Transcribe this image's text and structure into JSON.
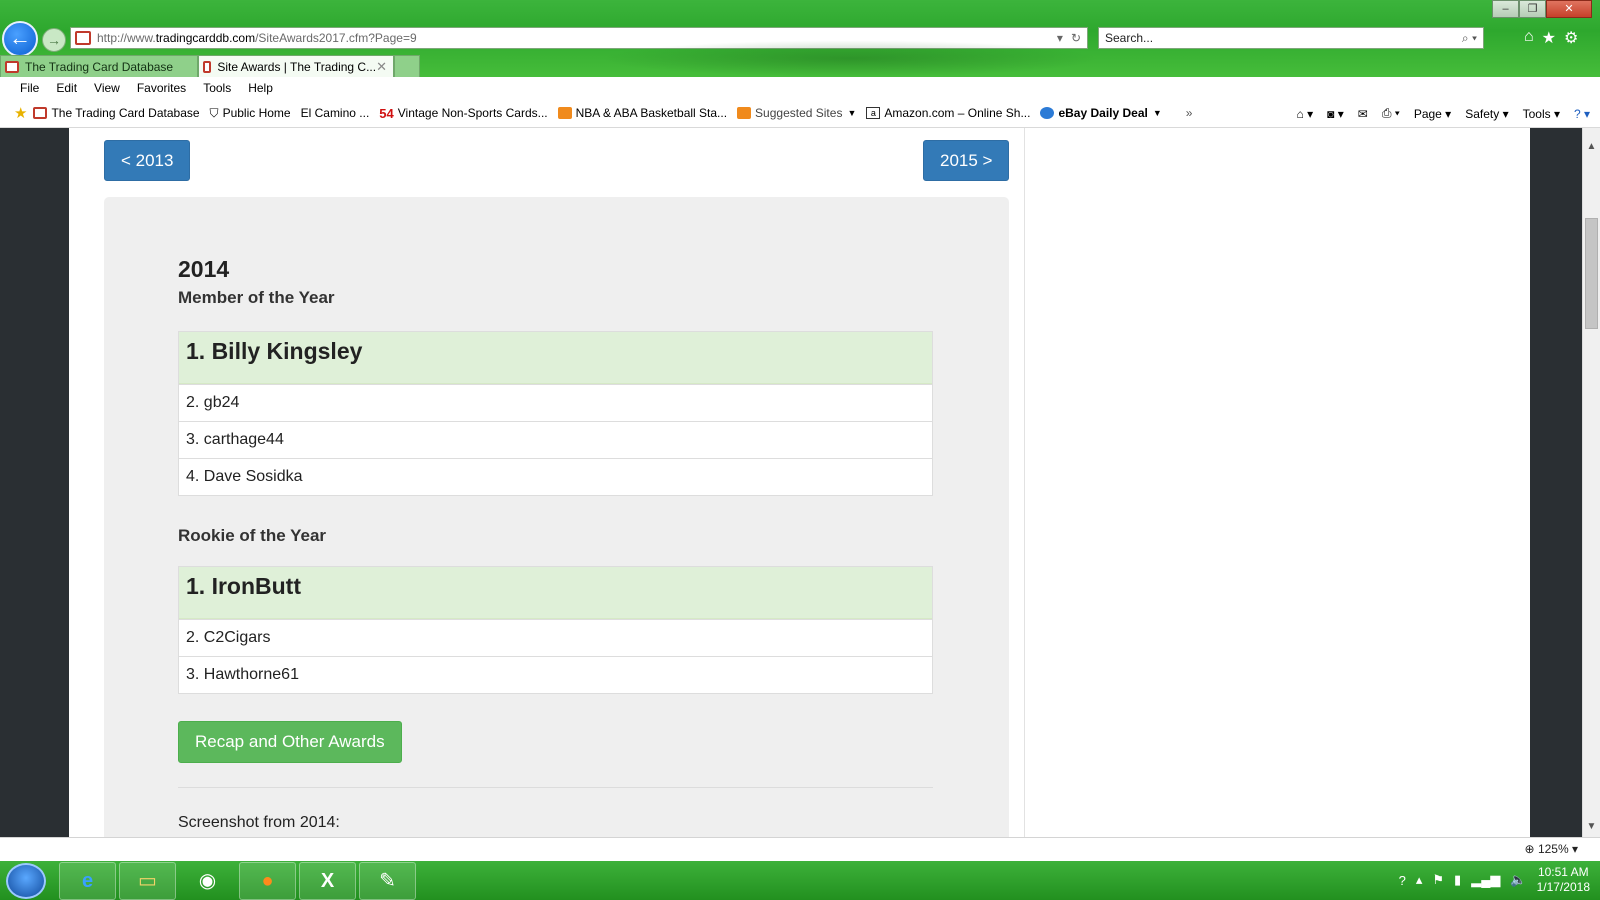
{
  "browser": {
    "url_prefix": "http://www.",
    "url_domain": "tradingcarddb.com",
    "url_path": "/SiteAwards2017.cfm?Page=9",
    "search_placeholder": "Search...",
    "tabs": [
      {
        "label": "The Trading Card Database"
      },
      {
        "label": "Site Awards | The Trading C..."
      }
    ],
    "menu": [
      "File",
      "Edit",
      "View",
      "Favorites",
      "Tools",
      "Help"
    ],
    "favorites": [
      {
        "label": "The Trading Card Database"
      },
      {
        "label": "Public Home"
      },
      {
        "label": "El Camino ..."
      },
      {
        "badge": "54",
        "label": "Vintage Non-Sports Cards..."
      },
      {
        "label": "NBA & ABA Basketball Sta..."
      },
      {
        "label": "Suggested Sites"
      },
      {
        "label": "Amazon.com – Online Sh..."
      },
      {
        "label": "eBay Daily Deal"
      }
    ],
    "commands": {
      "page": "Page",
      "safety": "Safety",
      "tools": "Tools"
    },
    "zoom": "125%"
  },
  "page": {
    "prev_year": "< 2013",
    "next_year": "2015 >",
    "year": "2014",
    "member_title": "Member of the Year",
    "member_winner": "1. Billy Kingsley",
    "member_rows": [
      "2. gb24",
      "3. carthage44",
      "4. Dave Sosidka"
    ],
    "rookie_title": "Rookie of the Year",
    "rookie_winner": "1. IronButt",
    "rookie_rows": [
      "2. C2Cigars",
      "3. Hawthorne61"
    ],
    "recap_button": "Recap and Other Awards",
    "screenshot_caption": "Screenshot from 2014:"
  },
  "taskbar": {
    "time": "10:51 AM",
    "date": "1/17/2018"
  },
  "colors": {
    "primary_button": "#337ab7",
    "success_button": "#5cb85c",
    "winner_row": "#dff0d8",
    "well": "#efefef",
    "chrome_green": "#3cb43c"
  }
}
